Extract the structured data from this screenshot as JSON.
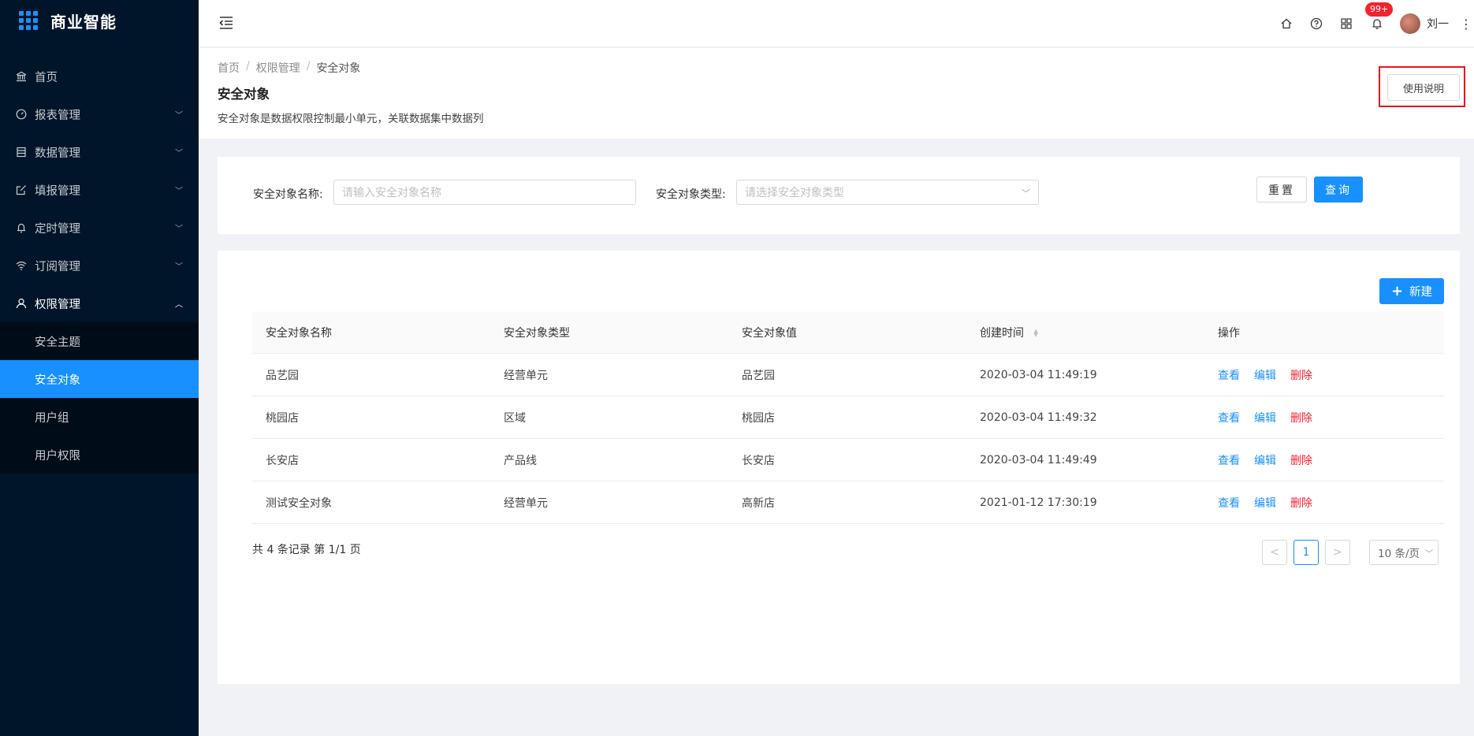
{
  "app": {
    "name": "商业智能"
  },
  "sidebar": {
    "items": [
      {
        "label": "首页",
        "icon": "bank-icon"
      },
      {
        "label": "报表管理",
        "icon": "dashboard-icon"
      },
      {
        "label": "数据管理",
        "icon": "database-icon"
      },
      {
        "label": "填报管理",
        "icon": "edit-icon"
      },
      {
        "label": "定时管理",
        "icon": "bell-icon"
      },
      {
        "label": "订阅管理",
        "icon": "wifi-icon"
      },
      {
        "label": "权限管理",
        "icon": "user-icon"
      }
    ],
    "subitems": [
      {
        "label": "安全主题"
      },
      {
        "label": "安全对象"
      },
      {
        "label": "用户组"
      },
      {
        "label": "用户权限"
      }
    ]
  },
  "header": {
    "notification_count": "99+",
    "username": "刘一"
  },
  "page": {
    "breadcrumb": [
      "首页",
      "权限管理",
      "安全对象"
    ],
    "title": "安全对象",
    "description": "安全对象是数据权限控制最小单元，关联数据集中数据列",
    "help_label": "使用说明"
  },
  "search": {
    "name_label": "安全对象名称:",
    "name_placeholder": "请输入安全对象名称",
    "type_label": "安全对象类型:",
    "type_placeholder": "请选择安全对象类型",
    "reset_label": "重置",
    "query_label": "查询"
  },
  "table": {
    "new_label": "新建",
    "columns": [
      "安全对象名称",
      "安全对象类型",
      "安全对象值",
      "创建时间",
      "操作"
    ],
    "rows": [
      [
        "品艺园",
        "经营单元",
        "品艺园",
        "2020-03-04 11:49:19"
      ],
      [
        "桃园店",
        "区域",
        "桃园店",
        "2020-03-04 11:49:32"
      ],
      [
        "长安店",
        "产品线",
        "长安店",
        "2020-03-04 11:49:49"
      ],
      [
        "测试安全对象",
        "经营单元",
        "高新店",
        "2021-01-12 17:30:19"
      ]
    ],
    "actions": {
      "view": "查看",
      "edit": "编辑",
      "delete": "删除"
    },
    "summary": "共 4 条记录 第 1/1 页",
    "pagination": {
      "current_page": "1",
      "page_size": "10 条/页"
    }
  },
  "colors": {
    "primary": "#1890ff",
    "danger": "#f5222d",
    "sidebar_bg": "#001529"
  }
}
